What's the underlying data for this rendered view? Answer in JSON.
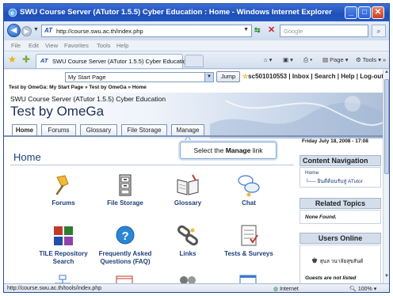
{
  "window": {
    "title": "SWU Course Server (ATutor 1.5.5) Cyber Education : Home - Windows Internet Explorer",
    "buttons": {
      "minimize": "_",
      "maximize": "□",
      "close": "✕"
    }
  },
  "address": {
    "url": "http://course.swu.ac.th/index.php",
    "search_placeholder": "Google"
  },
  "menubar": [
    "File",
    "Edit",
    "View",
    "Favorites",
    "Tools",
    "Help"
  ],
  "tabbar": {
    "active_tab": "SWU Course Server (ATutor 1.5.5) Cyber Education : ...",
    "page_label": "Page",
    "tools_label": "Tools",
    "more": "»"
  },
  "jump": {
    "select_value": "My Start Page",
    "button": "Jump",
    "user": "sc501010553",
    "links": "| Inbox | Search | Help | Log-out"
  },
  "breadcrumb": "Test by OmeGa: My Start Page » Test by OmeGa » Home",
  "banner": {
    "site_name": "SWU Course Server (ATutor 1.5.5) Cyber Education",
    "course_title": "Test by OmeGa"
  },
  "course_tabs": [
    "Home",
    "Forums",
    "Glossary",
    "File Storage",
    "Manage"
  ],
  "callout": {
    "before": "Select the ",
    "bold": "Manage",
    "after": " link"
  },
  "date": "Friday July 18, 2008 - 17:08",
  "home_title": "Home",
  "tools": [
    {
      "label": "Forums",
      "icon": "forum-pin-icon"
    },
    {
      "label": "File Storage",
      "icon": "file-cabinet-icon"
    },
    {
      "label": "Glossary",
      "icon": "glossary-book-icon"
    },
    {
      "label": "Chat",
      "icon": "chat-bubbles-icon"
    },
    {
      "label": "TILE Repository Search",
      "icon": "tile-repository-icon"
    },
    {
      "label": "Frequently Asked Questions (FAQ)",
      "icon": "faq-question-icon"
    },
    {
      "label": "Links",
      "icon": "links-chain-icon"
    },
    {
      "label": "Tests & Surveys",
      "icon": "tests-checklist-icon"
    }
  ],
  "sidebar": {
    "content_nav": {
      "title": "Content Navigation",
      "home": "Home",
      "item": "ยินดีต้อนรับสู่ ATutor"
    },
    "related": {
      "title": "Related Topics",
      "text": "None Found."
    },
    "users": {
      "title": "Users Online",
      "name": "สุนล วนาลัยสุขสันต์",
      "guests": "Guests are not listed"
    }
  },
  "status": {
    "url": "http://course.swu.ac.th/tools/index.php",
    "zone": "Internet",
    "zoom": "100%"
  }
}
